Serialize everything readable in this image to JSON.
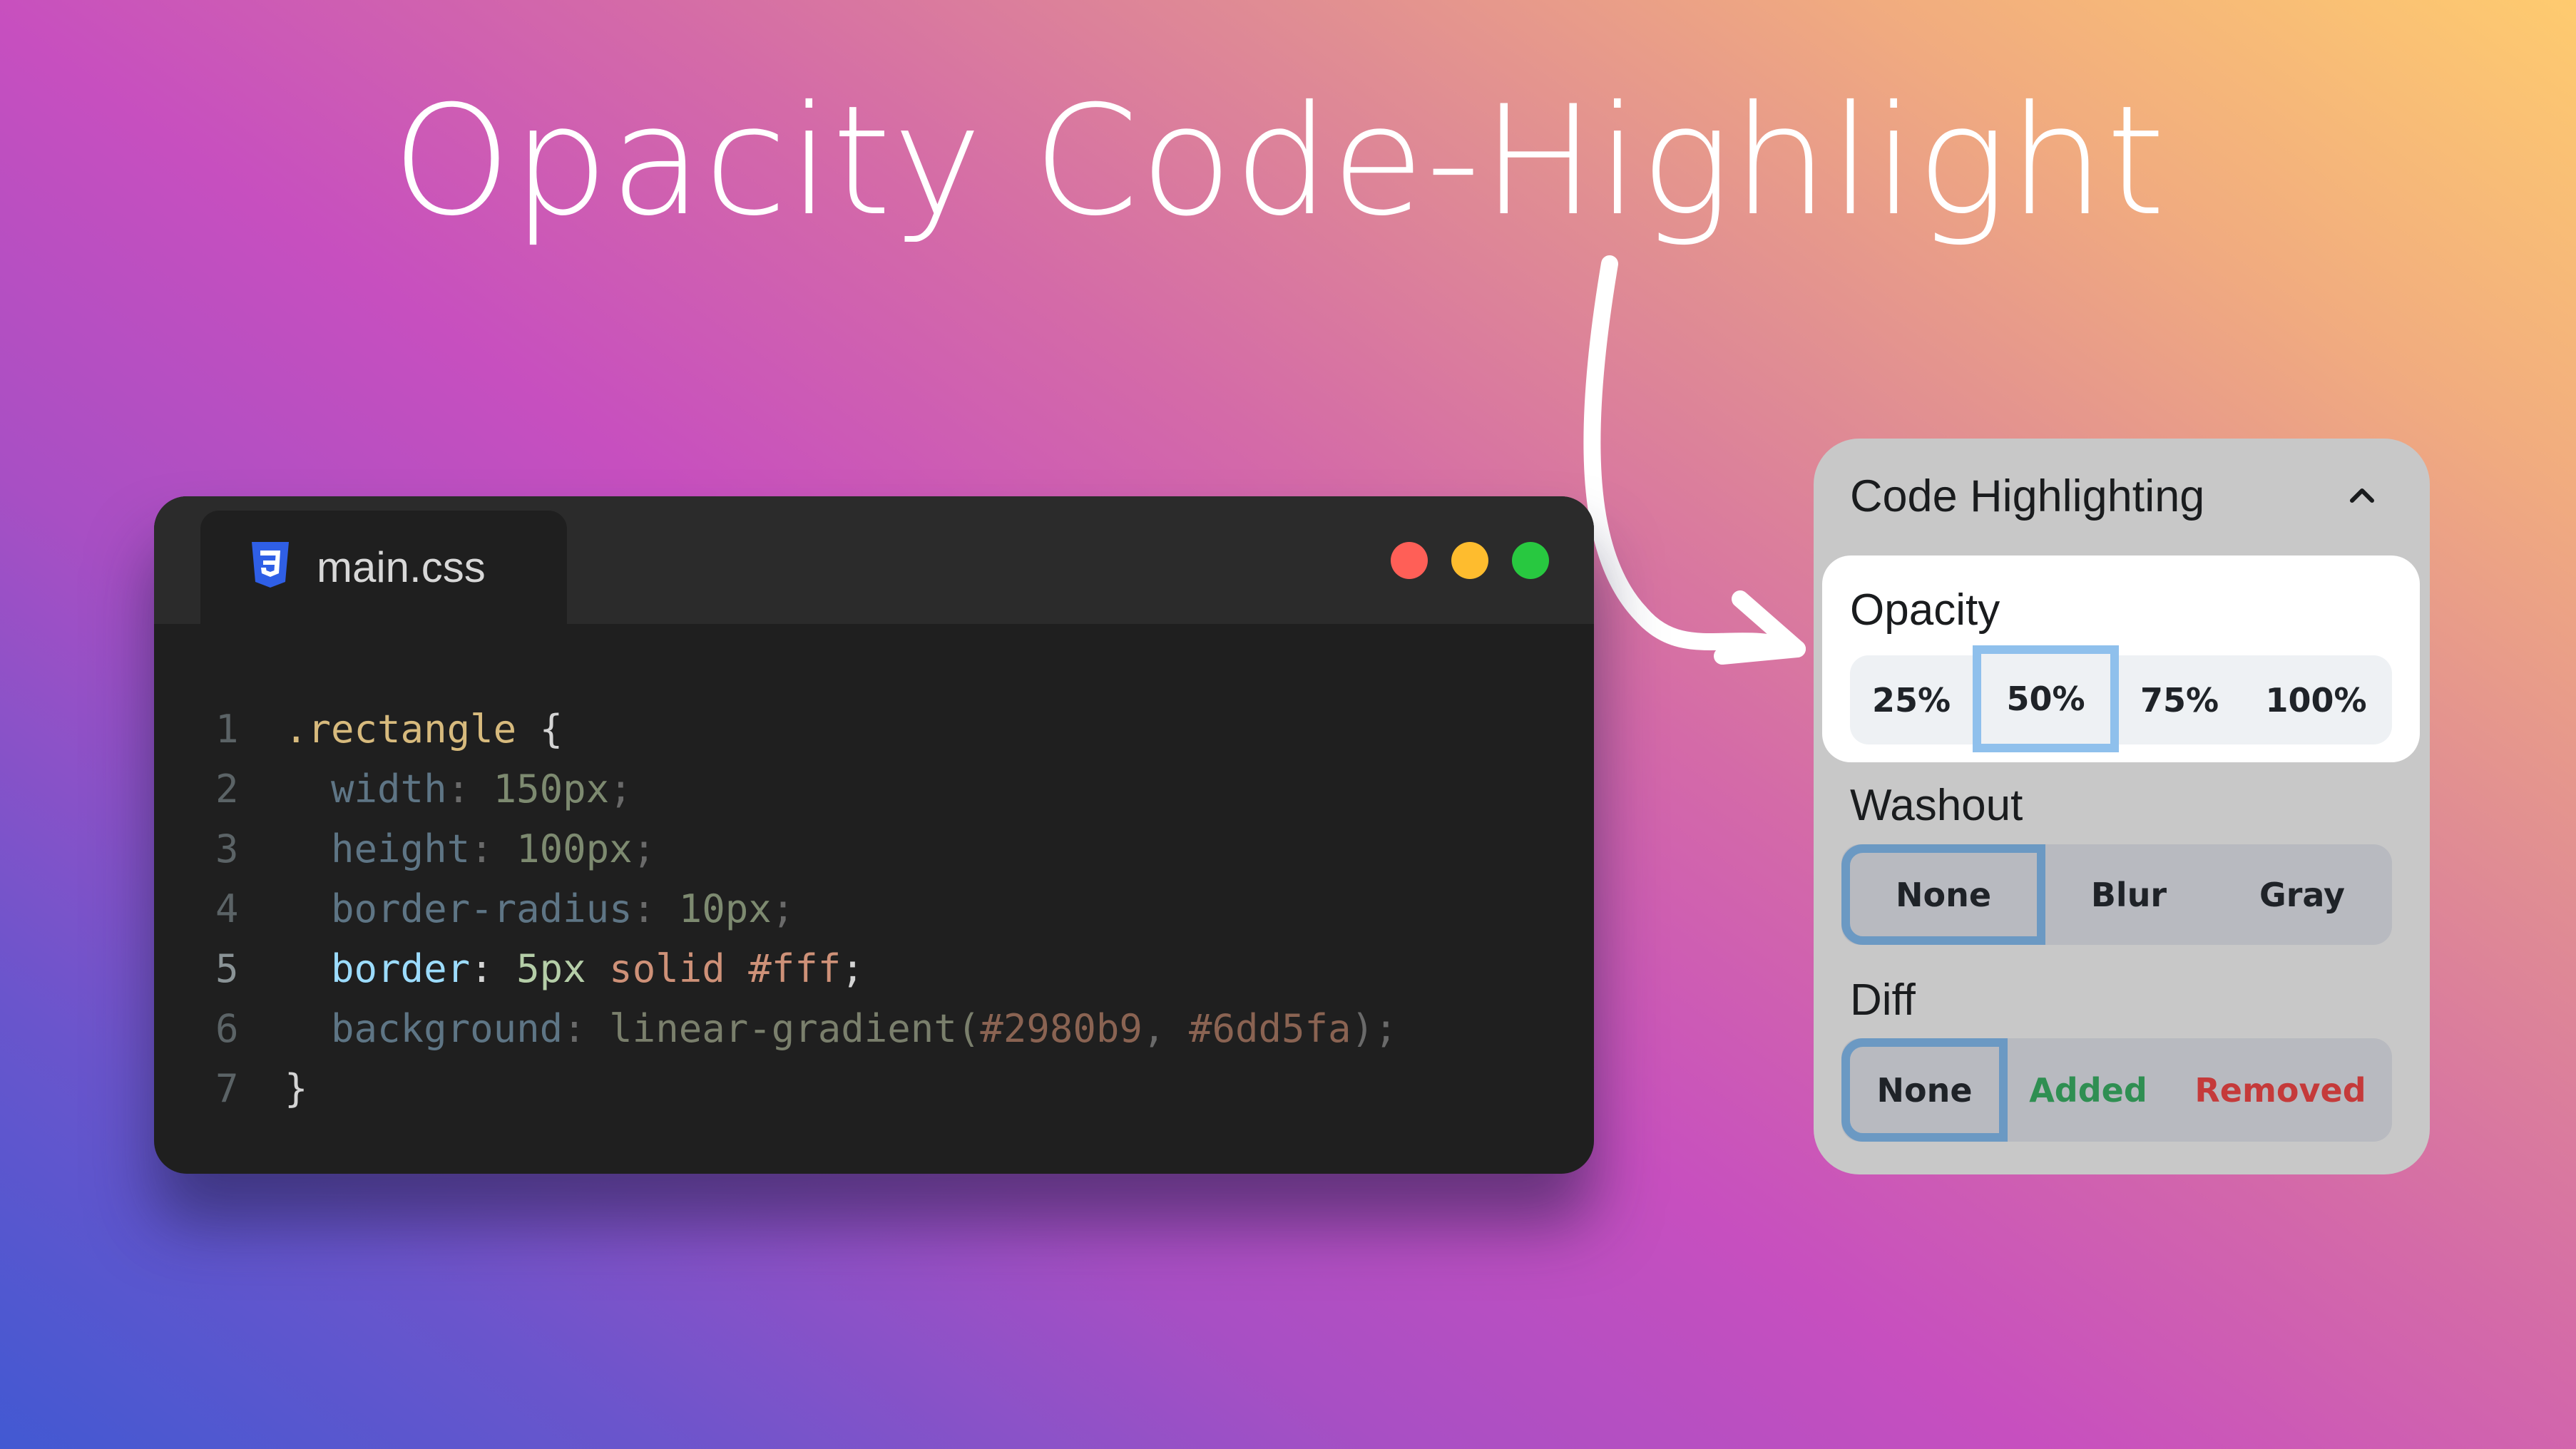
{
  "title": "Opacity Code-Highlight",
  "editor": {
    "tab_label": "main.css",
    "tab_icon": "css3-icon",
    "window_controls": [
      {
        "name": "close",
        "color": "#ff5f57"
      },
      {
        "name": "minimize",
        "color": "#febc2e"
      },
      {
        "name": "maximize",
        "color": "#28c840"
      }
    ],
    "lines": [
      {
        "num": "1",
        "tokens": [
          {
            "t": ".rectangle",
            "c": "c-sel"
          },
          {
            "t": " {",
            "c": "c-brace"
          }
        ]
      },
      {
        "num": "2",
        "tokens": [
          {
            "t": "  width",
            "c": "c-prop-dim"
          },
          {
            "t": ": ",
            "c": "c-colon-dim"
          },
          {
            "t": "150px",
            "c": "c-num-dim"
          },
          {
            "t": ";",
            "c": "c-punc-dim"
          }
        ]
      },
      {
        "num": "3",
        "tokens": [
          {
            "t": "  height",
            "c": "c-prop-dim"
          },
          {
            "t": ": ",
            "c": "c-colon-dim"
          },
          {
            "t": "100px",
            "c": "c-num-dim"
          },
          {
            "t": ";",
            "c": "c-punc-dim"
          }
        ]
      },
      {
        "num": "4",
        "tokens": [
          {
            "t": "  border-radius",
            "c": "c-prop-dim"
          },
          {
            "t": ": ",
            "c": "c-colon-dim"
          },
          {
            "t": "10px",
            "c": "c-num-dim"
          },
          {
            "t": ";",
            "c": "c-punc-dim"
          }
        ]
      },
      {
        "num": "5",
        "active": true,
        "tokens": [
          {
            "t": "  border",
            "c": "c-prop"
          },
          {
            "t": ": ",
            "c": "c-colon"
          },
          {
            "t": "5px",
            "c": "c-num"
          },
          {
            "t": " solid #fff",
            "c": "c-str"
          },
          {
            "t": ";",
            "c": "c-colon"
          }
        ]
      },
      {
        "num": "6",
        "tokens": [
          {
            "t": "  background",
            "c": "c-prop-dim"
          },
          {
            "t": ": ",
            "c": "c-colon-dim"
          },
          {
            "t": "linear-gradient(",
            "c": "c-func-dim"
          },
          {
            "t": "#2980b9",
            "c": "c-hex-dim"
          },
          {
            "t": ", ",
            "c": "c-punc-dim"
          },
          {
            "t": "#6dd5fa",
            "c": "c-hex-dim"
          },
          {
            "t": ");",
            "c": "c-punc-dim"
          }
        ]
      },
      {
        "num": "7",
        "tokens": [
          {
            "t": "}",
            "c": "c-brace"
          }
        ]
      }
    ]
  },
  "panel": {
    "title": "Code Highlighting",
    "collapse_icon": "chevron-up-icon",
    "opacity": {
      "label": "Opacity",
      "options": [
        "25%",
        "50%",
        "75%",
        "100%"
      ],
      "selected": "50%"
    },
    "washout": {
      "label": "Washout",
      "options": [
        "None",
        "Blur",
        "Gray"
      ],
      "selected": "None"
    },
    "diff": {
      "label": "Diff",
      "options": [
        "None",
        "Added",
        "Removed"
      ],
      "selected": "None",
      "colors": {
        "Added": "#2f8f52",
        "Removed": "#c53a3a"
      }
    }
  }
}
